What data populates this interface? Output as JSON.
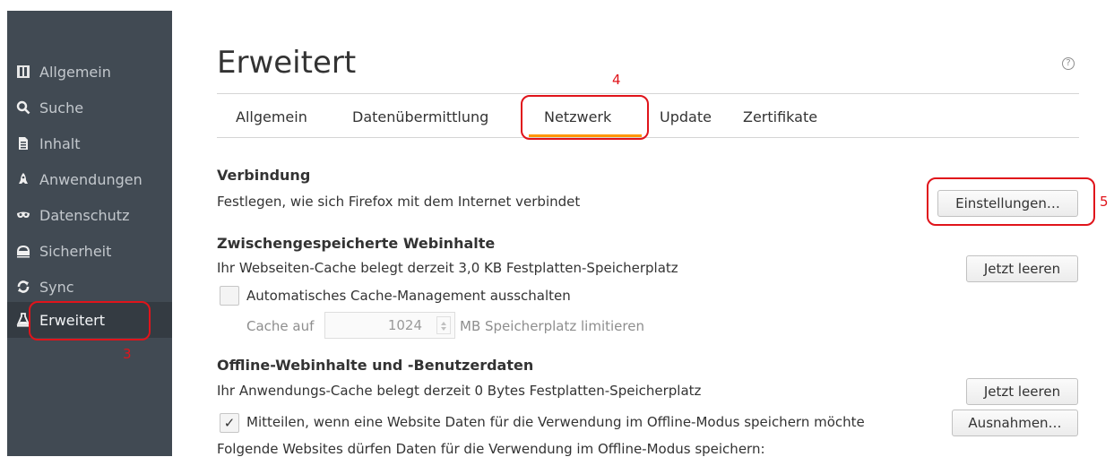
{
  "sidebar": {
    "items": [
      {
        "label": "Allgemein",
        "icon": "general-icon"
      },
      {
        "label": "Suche",
        "icon": "search-icon"
      },
      {
        "label": "Inhalt",
        "icon": "content-icon"
      },
      {
        "label": "Anwendungen",
        "icon": "applications-icon"
      },
      {
        "label": "Datenschutz",
        "icon": "privacy-mask-icon"
      },
      {
        "label": "Sicherheit",
        "icon": "security-icon"
      },
      {
        "label": "Sync",
        "icon": "sync-icon"
      },
      {
        "label": "Erweitert",
        "icon": "advanced-icon",
        "selected": true
      }
    ]
  },
  "page": {
    "title": "Erweitert",
    "help": "?"
  },
  "tabs": [
    {
      "label": "Allgemein"
    },
    {
      "label": "Datenübermittlung"
    },
    {
      "label": "Netzwerk",
      "selected": true
    },
    {
      "label": "Update"
    },
    {
      "label": "Zertifikate"
    }
  ],
  "connection": {
    "title": "Verbindung",
    "description": "Festlegen, wie sich Firefox mit dem Internet verbindet",
    "settings_button": "Einstellungen…"
  },
  "cache": {
    "title": "Zwischengespeicherte Webinhalte",
    "description": "Ihr Webseiten-Cache belegt derzeit 3,0 KB Festplatten-Speicherplatz",
    "clear_button": "Jetzt leeren",
    "override_label": "Automatisches Cache-Management ausschalten",
    "override_checked": false,
    "limit_prefix": "Cache auf",
    "limit_value": "1024",
    "limit_suffix": "MB Speicherplatz limitieren"
  },
  "offline": {
    "title": "Offline-Webinhalte und -Benutzerdaten",
    "description": "Ihr Anwendungs-Cache belegt derzeit 0 Bytes Festplatten-Speicherplatz",
    "clear_button": "Jetzt leeren",
    "notify_label": "Mitteilen, wenn eine Website Daten für die Verwendung im Offline-Modus speichern möchte",
    "notify_checked": true,
    "exceptions_button": "Ausnahmen…",
    "allowed_sites_label": "Folgende Websites dürfen Daten für die Verwendung im Offline-Modus speichern:"
  },
  "annotations": {
    "sidebar_marker": "3",
    "tab_marker": "4",
    "button_marker": "5",
    "color": "#e0141b"
  },
  "colors": {
    "sidebar_bg": "#414a53",
    "sidebar_selected": "#343b42",
    "tab_accent": "#ff9500"
  }
}
